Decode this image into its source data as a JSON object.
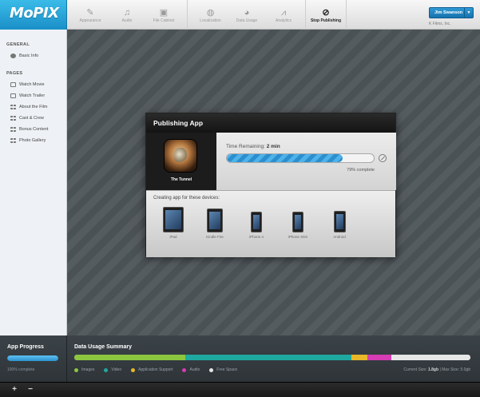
{
  "brand": {
    "logo": "MoPIX"
  },
  "toolbar": {
    "items": [
      {
        "label": "Appearance",
        "icon": "brush-icon"
      },
      {
        "label": "Audio",
        "icon": "music-note-icon"
      },
      {
        "label": "File Cabinet",
        "icon": "briefcase-icon"
      },
      {
        "label": "Localization",
        "icon": "globe-icon"
      },
      {
        "label": "Data Usage",
        "icon": "pie-chart-icon"
      },
      {
        "label": "Analytics",
        "icon": "line-chart-icon"
      },
      {
        "label": "Stop Publishing",
        "icon": "stop-icon"
      }
    ]
  },
  "user": {
    "name": "Jim Swanson",
    "caret": "▼",
    "company": "K Films, Inc."
  },
  "sidebar": {
    "general_title": "GENERAL",
    "general_items": [
      {
        "label": "Basic Info"
      }
    ],
    "pages_title": "PAGES",
    "pages_items": [
      {
        "label": "Watch Movie"
      },
      {
        "label": "Watch Trailer"
      },
      {
        "label": "About the Film"
      },
      {
        "label": "Cast & Crew"
      },
      {
        "label": "Bonus Content"
      },
      {
        "label": "Photo Gallery"
      }
    ]
  },
  "modal": {
    "title": "Publishing App",
    "app_name": "The Tunnel",
    "time_prefix": "Time Remaining:",
    "time_value": "2 min",
    "progress_percent": 79,
    "progress_text": "79% complete",
    "devices_label": "Creating app for these devices:",
    "devices": [
      {
        "name": "iPad",
        "w": 26,
        "h": 32
      },
      {
        "name": "Kindle Fire",
        "w": 20,
        "h": 30
      },
      {
        "name": "iPhone 4",
        "w": 14,
        "h": 26
      },
      {
        "name": "iPhone 3GS",
        "w": 14,
        "h": 26
      },
      {
        "name": "Android",
        "w": 15,
        "h": 27
      }
    ]
  },
  "app_progress": {
    "title": "App Progress",
    "percent": 100,
    "status": "100% complete"
  },
  "data_usage": {
    "title": "Data Usage Summary",
    "segments": [
      {
        "label": "Images",
        "percent": 28,
        "color": "#8cc63f"
      },
      {
        "label": "Video",
        "percent": 42,
        "color": "#1fa8a0"
      },
      {
        "label": "Application Support",
        "percent": 4,
        "color": "#e8b72a"
      },
      {
        "label": "Audio",
        "percent": 6,
        "color": "#d63cb3"
      },
      {
        "label": "Free Space",
        "percent": 20,
        "color": "#e6e6e6"
      }
    ],
    "current_size_label": "Current Size:",
    "current_size": "1.8gb",
    "max_size": "Max Size: 5.0gb"
  },
  "bottombar": {
    "zoom_in": "+",
    "zoom_out": "−"
  }
}
